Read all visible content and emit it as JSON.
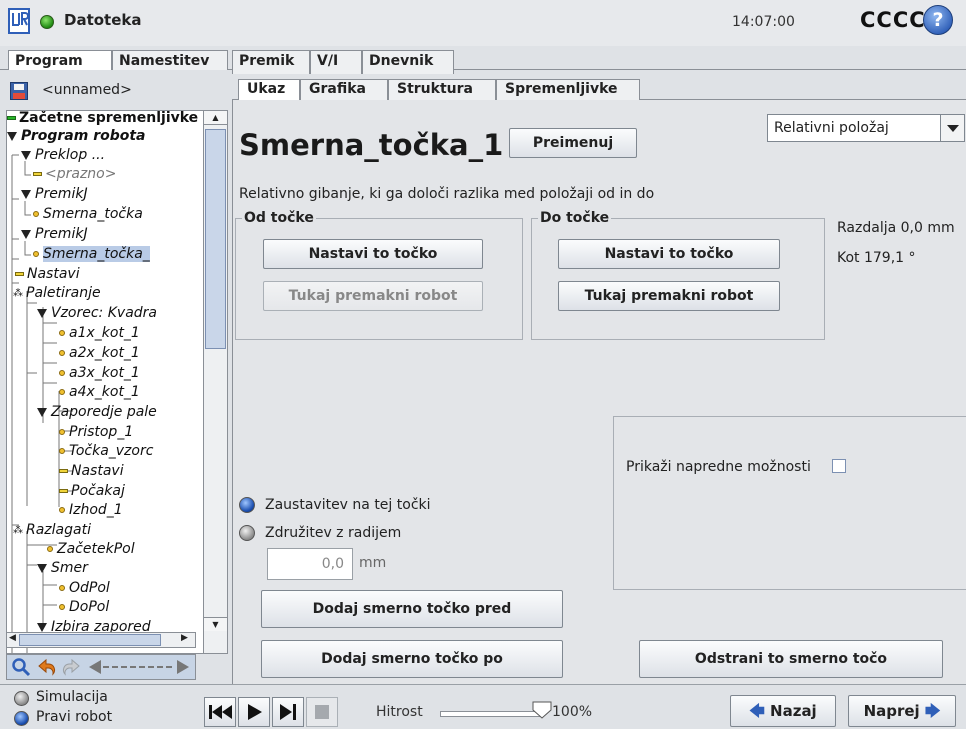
{
  "titlebar": {
    "app_title": "Datoteka",
    "clock": "14:07:00",
    "robot_name": "CCCC",
    "help_glyph": "?"
  },
  "main_tabs": [
    "Program",
    "Namestitev",
    "Premik",
    "V/I",
    "Dnevnik"
  ],
  "left_panel": {
    "file_name": "<unnamed>",
    "tree": [
      {
        "label": "Začetne spremenljivke",
        "bold": true,
        "icon": "green-mark"
      },
      {
        "label": "Program robota",
        "bold": true,
        "italic": true,
        "icon": "triangle"
      },
      {
        "label": "Preklop ...",
        "italic": true,
        "icon": "triangle"
      },
      {
        "label": "<prazno>",
        "italic": true,
        "gray": true,
        "icon": "yellow-mark"
      },
      {
        "label": "PremikJ",
        "italic": true,
        "icon": "triangle"
      },
      {
        "label": "Smerna_točka",
        "italic": true,
        "icon": "dot"
      },
      {
        "label": "PremikJ",
        "italic": true,
        "icon": "triangle"
      },
      {
        "label": "Smerna_točka_",
        "italic": true,
        "icon": "dot",
        "selected": true
      },
      {
        "label": "Nastavi",
        "italic": true,
        "icon": "yellow-mark"
      },
      {
        "label": "Paletiranje",
        "italic": true,
        "icon": "pallet"
      },
      {
        "label": "Vzorec: Kvadra",
        "italic": true,
        "icon": "triangle"
      },
      {
        "label": "a1x_kot_1",
        "italic": true,
        "icon": "dot"
      },
      {
        "label": "a2x_kot_1",
        "italic": true,
        "icon": "dot"
      },
      {
        "label": "a3x_kot_1",
        "italic": true,
        "icon": "dot"
      },
      {
        "label": "a4x_kot_1",
        "italic": true,
        "icon": "dot"
      },
      {
        "label": "Zaporedje pale",
        "italic": true,
        "icon": "triangle"
      },
      {
        "label": "Pristop_1",
        "italic": true,
        "icon": "dot"
      },
      {
        "label": "Točka_vzorc",
        "italic": true,
        "icon": "dot"
      },
      {
        "label": "Nastavi",
        "italic": true,
        "icon": "yellow-mark"
      },
      {
        "label": "Počakaj",
        "italic": true,
        "icon": "yellow-mark"
      },
      {
        "label": "Izhod_1",
        "italic": true,
        "icon": "dot"
      },
      {
        "label": "Razlagati",
        "italic": true,
        "icon": "pallet"
      },
      {
        "label": "ZačetekPol",
        "italic": true,
        "icon": "dot"
      },
      {
        "label": "Smer",
        "italic": true,
        "icon": "triangle"
      },
      {
        "label": "OdPol",
        "italic": true,
        "icon": "dot"
      },
      {
        "label": "DoPol",
        "italic": true,
        "icon": "dot"
      },
      {
        "label": "Izbira zapored",
        "italic": true,
        "icon": "triangle"
      }
    ]
  },
  "content_tabs": [
    "Ukaz",
    "Grafika",
    "Struktura",
    "Spremenljivke"
  ],
  "command": {
    "waypoint_name": "Smerna_točka_1",
    "rename_button": "Preimenuj",
    "position_mode": "Relativni položaj",
    "description": "Relativno gibanje, ki ga določi razlika med položaji od in do",
    "from_group": {
      "title": "Od točke",
      "set_button": "Nastavi to točko",
      "move_button": "Tukaj premakni robot"
    },
    "to_group": {
      "title": "Do točke",
      "set_button": "Nastavi to točko",
      "move_button": "Tukaj premakni robot"
    },
    "distance": "Razdalja 0,0 mm",
    "angle": "Kot 179,1 °",
    "advanced_label": "Prikaži napredne možnosti",
    "advanced_checked": false,
    "stop_option": "Zaustavitev na tej točki",
    "blend_option": "Združitev z radijem",
    "selected_option": "stop",
    "blend_radius": "0,0",
    "blend_unit": "mm",
    "add_before_button": "Dodaj smerno točko pred",
    "add_after_button": "Dodaj smerno točko po",
    "remove_button": "Odstrani to smerno točo"
  },
  "bottombar": {
    "simulation_label": "Simulacija",
    "real_robot_label": "Pravi robot",
    "mode": "real",
    "speed_label": "Hitrost",
    "speed_value": "100%",
    "speed_fraction": 1.0,
    "back_button": "Nazaj",
    "next_button": "Naprej"
  },
  "colors": {
    "accent": "#2f5fb8",
    "selection": "#b9cbe6",
    "status_ok": "#29b629"
  }
}
